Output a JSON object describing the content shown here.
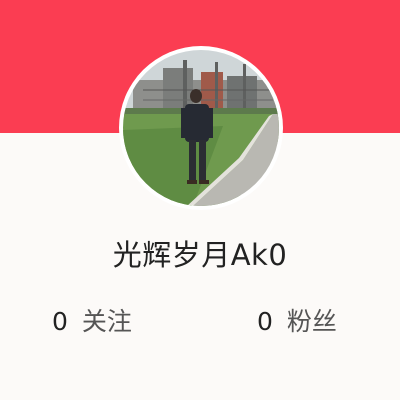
{
  "theme": {
    "accent": "#fb3d52",
    "background": "#fcfaf8"
  },
  "profile": {
    "avatar_icon": "user-avatar-photo",
    "username": "光辉岁月Ak0"
  },
  "stats": {
    "following_count": "0",
    "following_label": "关注",
    "followers_count": "0",
    "followers_label": "粉丝"
  }
}
